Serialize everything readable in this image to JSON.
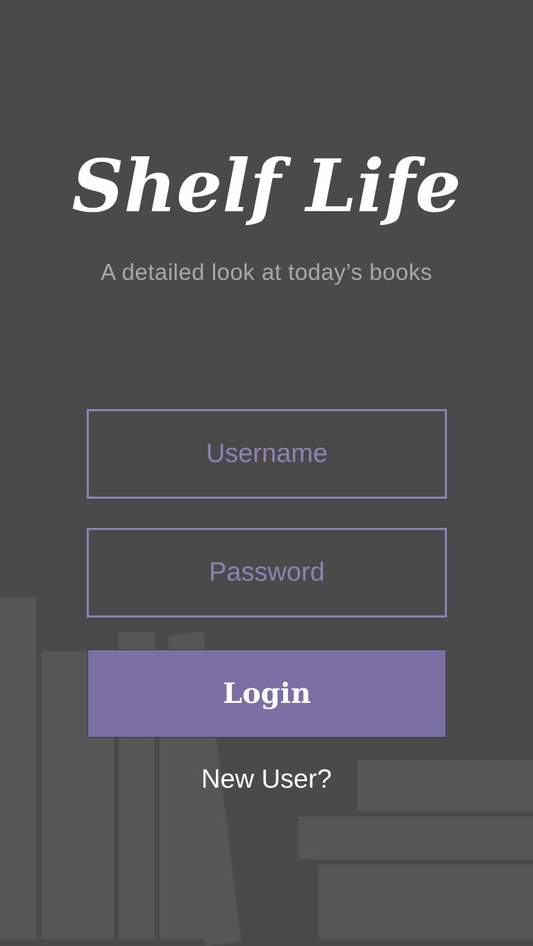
{
  "app": {
    "title": "Shelf Life",
    "tagline": "A detailed look at today’s books"
  },
  "form": {
    "username_placeholder": "Username",
    "username_value": "",
    "password_placeholder": "Password",
    "password_value": "",
    "login_label": "Login",
    "new_user_label": "New User?"
  },
  "colors": {
    "background": "#4a4a4a",
    "accent": "#7a70a3",
    "field_border": "#8d82b3",
    "book_shape": "#555756",
    "title_text": "#ffffff",
    "tagline_text": "#a8a8a8"
  }
}
